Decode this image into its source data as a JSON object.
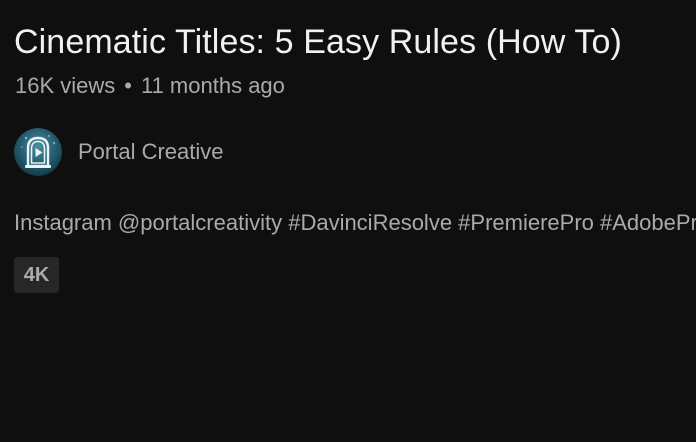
{
  "video": {
    "title": "Cinematic Titles: 5 Easy Rules (How To)",
    "views": "16K views",
    "separator": "•",
    "age": "11 months ago"
  },
  "channel": {
    "name": "Portal Creative",
    "avatar_icon": "portal-door-logo-icon"
  },
  "description": {
    "text": "Instagram @portalcreativity #DavinciResolve #PremierePro #AdobePremiere"
  },
  "badges": {
    "quality": "4K"
  },
  "colors": {
    "background": "#0f0f0f",
    "title_text": "#f1f1f1",
    "secondary_text": "#aaaaaa",
    "badge_bg": "#272727"
  }
}
